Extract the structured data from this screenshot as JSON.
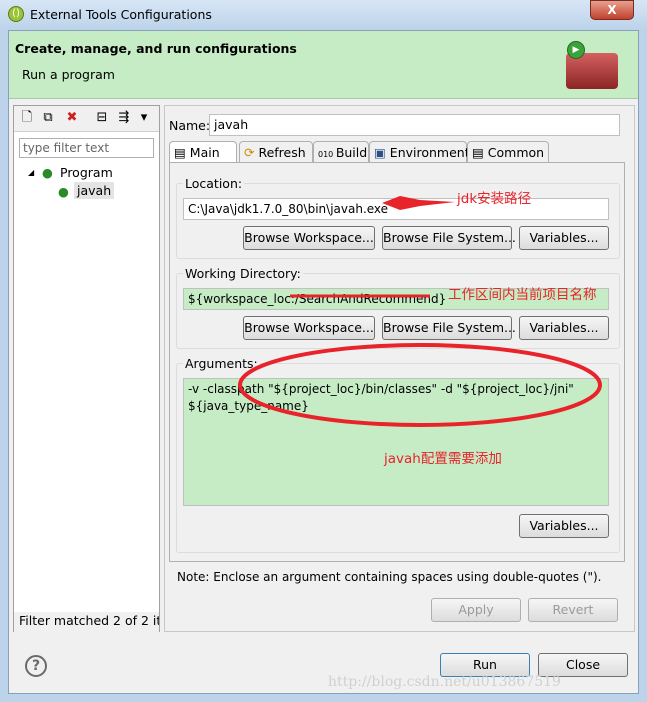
{
  "window": {
    "title": "External Tools Configurations",
    "close": "X"
  },
  "banner": {
    "title": "Create, manage, and run configurations",
    "subtitle": "Run a program"
  },
  "left": {
    "toolbar": [
      {
        "icon": "new-config-icon",
        "glyph": "🗋"
      },
      {
        "icon": "duplicate-icon",
        "glyph": "⧉"
      },
      {
        "icon": "delete-icon",
        "glyph": "✖"
      },
      {
        "icon": "collapse-all-icon",
        "glyph": "⊟"
      },
      {
        "icon": "filter-icon",
        "glyph": "⇶"
      },
      {
        "icon": "dropdown-icon",
        "glyph": "▾"
      }
    ],
    "filter_placeholder": "type filter text",
    "tree": [
      {
        "label": "Program",
        "expander": "◢"
      },
      {
        "label": "javah"
      }
    ],
    "status": "Filter matched 2 of 2 items"
  },
  "right": {
    "name_label": "Name:",
    "name_value": "javah",
    "tabs": [
      "Main",
      "Refresh",
      "Build",
      "Environment",
      "Common"
    ],
    "location": {
      "label": "Location:",
      "value": "C:\\Java\\jdk1.7.0_80\\bin\\javah.exe"
    },
    "working_dir": {
      "label": "Working Directory:",
      "value": "${workspace_loc:/SearchAndRecommend}"
    },
    "arguments": {
      "label": "Arguments:",
      "line1": "-v -classpath \"${project_loc}/bin/classes\" -d \"${project_loc}/jni\"",
      "line2": "${java_type_name}"
    },
    "buttons": {
      "browse_workspace": "Browse Workspace...",
      "browse_fs": "Browse File System...",
      "variables": "Variables..."
    },
    "note": "Note: Enclose an argument containing spaces using double-quotes (\").",
    "apply": "Apply",
    "revert": "Revert"
  },
  "annotations": {
    "jdk": "jdk安装路径",
    "workspace": "工作区间内当前项目名称",
    "javah": "javah配置需要添加"
  },
  "footer": {
    "help": "?",
    "run": "Run",
    "close": "Close"
  },
  "watermark": "http://blog.csdn.net/u013867519",
  "colors": {
    "banner": "#c6ecc6",
    "annotation": "#e8232a"
  }
}
